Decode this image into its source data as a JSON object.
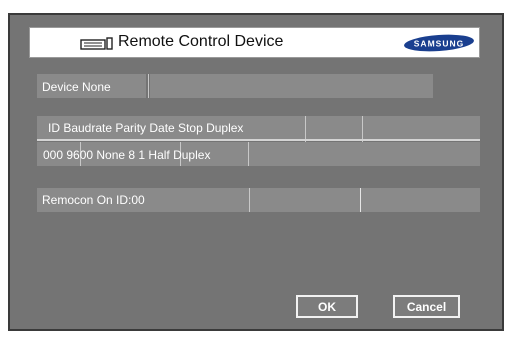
{
  "window": {
    "title": "Remote Control Device",
    "brand_logo": "SAMSUNG",
    "icon": "remote-control-icon"
  },
  "device": {
    "label": "Device None"
  },
  "table": {
    "header": "ID Baudrate Parity Date Stop Duplex",
    "row": "000 9600 None 8 1 Half Duplex"
  },
  "remocon": {
    "label": "Remocon On ID:00"
  },
  "buttons": {
    "ok": "OK",
    "cancel": "Cancel"
  },
  "colors": {
    "panel": "#747474",
    "field": "#8a8a8a",
    "text": "#ffffff"
  }
}
